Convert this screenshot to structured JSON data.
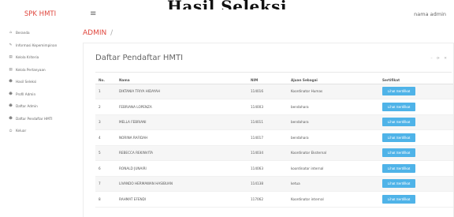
{
  "caption": "Hasil Seleksi",
  "app": {
    "brand": "SPK HMTI",
    "user_label": "nama admin"
  },
  "sidebar": {
    "items": [
      {
        "label": "Beranda",
        "icon": "home-icon",
        "glyph": "⌂"
      },
      {
        "label": "Informasi Kepemimpinan",
        "icon": "edit-icon",
        "glyph": "✎"
      },
      {
        "label": "Kelola Kriteria",
        "icon": "list-icon",
        "glyph": "▤"
      },
      {
        "label": "Kelola Pertanyaan",
        "icon": "list-icon",
        "glyph": "▤"
      },
      {
        "label": "Hasil Seleksi",
        "icon": "users-icon",
        "glyph": "☻"
      },
      {
        "label": "Profil Admin",
        "icon": "user-icon",
        "glyph": "☻"
      },
      {
        "label": "Daftar Admin",
        "icon": "users-icon",
        "glyph": "☻"
      },
      {
        "label": "Daftar Pendaftar HMTI",
        "icon": "users-icon",
        "glyph": "☻"
      },
      {
        "label": "Keluar",
        "icon": "logout-icon",
        "glyph": "⏻"
      }
    ]
  },
  "breadcrumb": {
    "text": "ADMIN",
    "sep": "/"
  },
  "card": {
    "title": "Daftar Pendaftar HMTI",
    "tools": "– ⟳ ✕"
  },
  "table": {
    "headers": [
      "No.",
      "Nama",
      "NIM",
      "Ajuan Sebagai",
      "Sertifikat"
    ],
    "button_label": "Lihat Sertifikat",
    "rows": [
      {
        "no": "1",
        "nama": "DIKTANIA TRIYA HIDAYAH",
        "nim": "114016",
        "ajuan": "Koordinator Humas"
      },
      {
        "no": "2",
        "nama": "FEBRIANA LOPENZA",
        "nim": "114003",
        "ajuan": "bendahara"
      },
      {
        "no": "3",
        "nama": "MELLA FEBRIANI",
        "nim": "114011",
        "ajuan": "bendahara"
      },
      {
        "no": "4",
        "nama": "NORINA RAFIDAH",
        "nim": "114017",
        "ajuan": "bendahara"
      },
      {
        "no": "5",
        "nama": "REBECCA REKINVITA",
        "nim": "114034",
        "ajuan": "Koordinator Eksternal"
      },
      {
        "no": "6",
        "nama": "RONALD JUNAIRI",
        "nim": "114063",
        "ajuan": "koordinator internal"
      },
      {
        "no": "7",
        "nama": "LIVANDO HERMAWAN HASIBUAN",
        "nim": "114138",
        "ajuan": "ketua"
      },
      {
        "no": "8",
        "nama": "RAHMAT EFENDI",
        "nim": "117062",
        "ajuan": "Koordinator internal"
      }
    ]
  }
}
